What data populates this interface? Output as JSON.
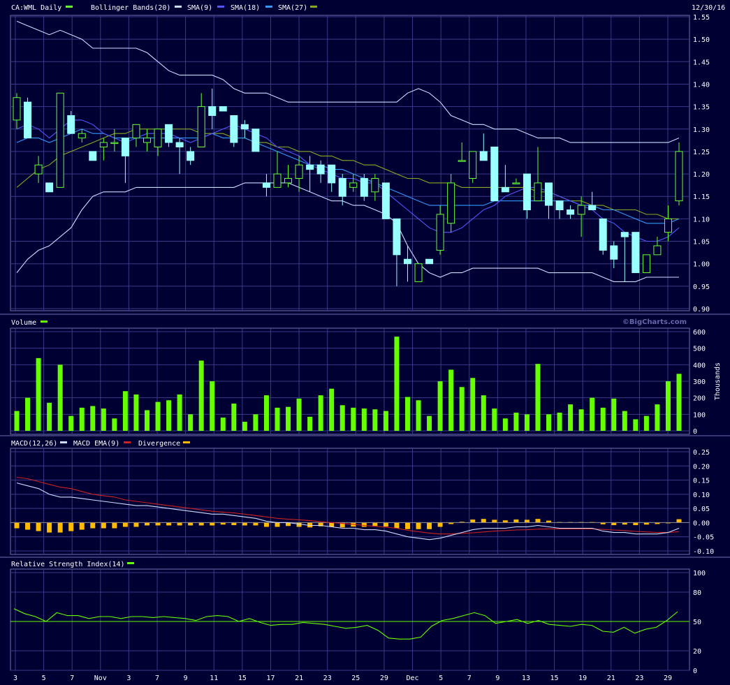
{
  "header": {
    "symbol_label": "CA:WML Daily",
    "bb_label": "Bollinger Bands(20)",
    "sma9_label": "SMA(9)",
    "sma18_label": "SMA(18)",
    "sma27_label": "SMA(27)",
    "date_label": "12/30/16"
  },
  "colors": {
    "background": "#000033",
    "grid": "#3a3a8a",
    "up": "#000033",
    "up_border": "#66ff33",
    "down": "#99ffff",
    "bollinger": "#ccddff",
    "sma9": "#5555ff",
    "sma18": "#3399ff",
    "sma27": "#88aa22",
    "volume": "#66ff00",
    "macd": "#ccddff",
    "macd_ema": "#cc2222",
    "divergence": "#ffbb00",
    "rsi": "#66ff00"
  },
  "watermark": "©BigCharts.com",
  "chart_data": [
    {
      "type": "candlestick",
      "title": "CA:WML Daily",
      "ylim": [
        0.9,
        1.55
      ],
      "yticks": [
        "1.55",
        "1.50",
        "1.45",
        "1.40",
        "1.35",
        "1.30",
        "1.25",
        "1.20",
        "1.15",
        "1.10",
        "1.05",
        "1.00",
        "0.95",
        "0.90"
      ],
      "xticks": [
        "3",
        "5",
        "7",
        "Nov",
        "3",
        "7",
        "9",
        "11",
        "15",
        "17",
        "21",
        "23",
        "25",
        "29",
        "Dec",
        "5",
        "7",
        "9",
        "13",
        "15",
        "19",
        "21",
        "23",
        "29"
      ],
      "candles": [
        {
          "o": 1.32,
          "h": 1.38,
          "l": 1.3,
          "c": 1.37
        },
        {
          "o": 1.36,
          "h": 1.37,
          "l": 1.28,
          "c": 1.28
        },
        {
          "o": 1.2,
          "h": 1.24,
          "l": 1.18,
          "c": 1.22
        },
        {
          "o": 1.18,
          "h": 1.18,
          "l": 1.16,
          "c": 1.16
        },
        {
          "o": 1.17,
          "h": 1.38,
          "l": 1.17,
          "c": 1.38
        },
        {
          "o": 1.33,
          "h": 1.34,
          "l": 1.29,
          "c": 1.29
        },
        {
          "o": 1.28,
          "h": 1.3,
          "l": 1.27,
          "c": 1.29
        },
        {
          "o": 1.25,
          "h": 1.25,
          "l": 1.23,
          "c": 1.23
        },
        {
          "o": 1.26,
          "h": 1.28,
          "l": 1.23,
          "c": 1.27
        },
        {
          "o": 1.27,
          "h": 1.3,
          "l": 1.25,
          "c": 1.27
        },
        {
          "o": 1.28,
          "h": 1.28,
          "l": 1.18,
          "c": 1.24
        },
        {
          "o": 1.28,
          "h": 1.31,
          "l": 1.26,
          "c": 1.31
        },
        {
          "o": 1.27,
          "h": 1.3,
          "l": 1.25,
          "c": 1.28
        },
        {
          "o": 1.26,
          "h": 1.3,
          "l": 1.24,
          "c": 1.3
        },
        {
          "o": 1.31,
          "h": 1.31,
          "l": 1.26,
          "c": 1.27
        },
        {
          "o": 1.27,
          "h": 1.28,
          "l": 1.2,
          "c": 1.26
        },
        {
          "o": 1.25,
          "h": 1.26,
          "l": 1.22,
          "c": 1.23
        },
        {
          "o": 1.26,
          "h": 1.38,
          "l": 1.26,
          "c": 1.35
        },
        {
          "o": 1.35,
          "h": 1.39,
          "l": 1.3,
          "c": 1.33
        },
        {
          "o": 1.35,
          "h": 1.35,
          "l": 1.34,
          "c": 1.34
        },
        {
          "o": 1.33,
          "h": 1.33,
          "l": 1.26,
          "c": 1.27
        },
        {
          "o": 1.31,
          "h": 1.32,
          "l": 1.28,
          "c": 1.3
        },
        {
          "o": 1.3,
          "h": 1.3,
          "l": 1.25,
          "c": 1.25
        },
        {
          "o": 1.18,
          "h": 1.2,
          "l": 1.15,
          "c": 1.17
        },
        {
          "o": 1.17,
          "h": 1.25,
          "l": 1.17,
          "c": 1.2
        },
        {
          "o": 1.18,
          "h": 1.22,
          "l": 1.17,
          "c": 1.19
        },
        {
          "o": 1.19,
          "h": 1.24,
          "l": 1.16,
          "c": 1.22
        },
        {
          "o": 1.22,
          "h": 1.24,
          "l": 1.16,
          "c": 1.21
        },
        {
          "o": 1.22,
          "h": 1.23,
          "l": 1.18,
          "c": 1.2
        },
        {
          "o": 1.22,
          "h": 1.22,
          "l": 1.16,
          "c": 1.18
        },
        {
          "o": 1.19,
          "h": 1.2,
          "l": 1.13,
          "c": 1.15
        },
        {
          "o": 1.17,
          "h": 1.2,
          "l": 1.16,
          "c": 1.18
        },
        {
          "o": 1.19,
          "h": 1.2,
          "l": 1.14,
          "c": 1.15
        },
        {
          "o": 1.16,
          "h": 1.2,
          "l": 1.14,
          "c": 1.19
        },
        {
          "o": 1.18,
          "h": 1.18,
          "l": 1.1,
          "c": 1.1
        },
        {
          "o": 1.1,
          "h": 1.1,
          "l": 0.95,
          "c": 1.02
        },
        {
          "o": 1.01,
          "h": 1.04,
          "l": 0.96,
          "c": 1.0
        },
        {
          "o": 0.96,
          "h": 1.0,
          "l": 0.96,
          "c": 1.0
        },
        {
          "o": 1.01,
          "h": 1.01,
          "l": 1.0,
          "c": 1.0
        },
        {
          "o": 1.03,
          "h": 1.13,
          "l": 1.02,
          "c": 1.11
        },
        {
          "o": 1.09,
          "h": 1.2,
          "l": 1.07,
          "c": 1.18
        },
        {
          "o": 1.23,
          "h": 1.27,
          "l": 1.23,
          "c": 1.23
        },
        {
          "o": 1.19,
          "h": 1.25,
          "l": 1.18,
          "c": 1.25
        },
        {
          "o": 1.25,
          "h": 1.29,
          "l": 1.23,
          "c": 1.23
        },
        {
          "o": 1.26,
          "h": 1.26,
          "l": 1.14,
          "c": 1.14
        },
        {
          "o": 1.17,
          "h": 1.22,
          "l": 1.16,
          "c": 1.16
        },
        {
          "o": 1.18,
          "h": 1.19,
          "l": 1.18,
          "c": 1.18
        },
        {
          "o": 1.2,
          "h": 1.2,
          "l": 1.1,
          "c": 1.12
        },
        {
          "o": 1.14,
          "h": 1.26,
          "l": 1.14,
          "c": 1.18
        },
        {
          "o": 1.18,
          "h": 1.18,
          "l": 1.1,
          "c": 1.13
        },
        {
          "o": 1.14,
          "h": 1.14,
          "l": 1.1,
          "c": 1.12
        },
        {
          "o": 1.12,
          "h": 1.13,
          "l": 1.1,
          "c": 1.11
        },
        {
          "o": 1.11,
          "h": 1.15,
          "l": 1.06,
          "c": 1.13
        },
        {
          "o": 1.13,
          "h": 1.16,
          "l": 1.12,
          "c": 1.12
        },
        {
          "o": 1.1,
          "h": 1.1,
          "l": 1.02,
          "c": 1.03
        },
        {
          "o": 1.04,
          "h": 1.05,
          "l": 0.99,
          "c": 1.01
        },
        {
          "o": 1.07,
          "h": 1.07,
          "l": 0.96,
          "c": 1.06
        },
        {
          "o": 1.07,
          "h": 1.07,
          "l": 0.98,
          "c": 0.98
        },
        {
          "o": 0.98,
          "h": 1.02,
          "l": 0.98,
          "c": 1.02
        },
        {
          "o": 1.02,
          "h": 1.06,
          "l": 1.02,
          "c": 1.04
        },
        {
          "o": 1.07,
          "h": 1.13,
          "l": 1.05,
          "c": 1.1
        },
        {
          "o": 1.14,
          "h": 1.27,
          "l": 1.13,
          "c": 1.25
        }
      ],
      "bollinger_upper": [
        1.54,
        1.53,
        1.52,
        1.51,
        1.52,
        1.51,
        1.5,
        1.48,
        1.48,
        1.48,
        1.48,
        1.48,
        1.47,
        1.45,
        1.43,
        1.42,
        1.42,
        1.42,
        1.42,
        1.41,
        1.39,
        1.38,
        1.38,
        1.38,
        1.37,
        1.36,
        1.36,
        1.36,
        1.36,
        1.36,
        1.36,
        1.36,
        1.36,
        1.36,
        1.36,
        1.36,
        1.38,
        1.39,
        1.38,
        1.36,
        1.33,
        1.32,
        1.31,
        1.31,
        1.3,
        1.3,
        1.3,
        1.29,
        1.28,
        1.28,
        1.28,
        1.27,
        1.27,
        1.27,
        1.27,
        1.27,
        1.27,
        1.27,
        1.27,
        1.27,
        1.27,
        1.28
      ],
      "bollinger_lower": [
        0.98,
        1.01,
        1.03,
        1.04,
        1.06,
        1.08,
        1.12,
        1.15,
        1.16,
        1.16,
        1.16,
        1.17,
        1.17,
        1.17,
        1.17,
        1.17,
        1.17,
        1.17,
        1.17,
        1.17,
        1.17,
        1.18,
        1.18,
        1.18,
        1.18,
        1.18,
        1.17,
        1.16,
        1.15,
        1.14,
        1.14,
        1.13,
        1.13,
        1.12,
        1.11,
        1.09,
        1.04,
        1.0,
        0.98,
        0.97,
        0.98,
        0.98,
        0.99,
        0.99,
        0.99,
        0.99,
        0.99,
        0.99,
        0.99,
        0.98,
        0.98,
        0.98,
        0.98,
        0.98,
        0.97,
        0.96,
        0.96,
        0.96,
        0.97,
        0.97,
        0.97,
        0.97
      ],
      "sma9": [
        1.3,
        1.31,
        1.3,
        1.28,
        1.3,
        1.32,
        1.32,
        1.31,
        1.29,
        1.28,
        1.27,
        1.28,
        1.29,
        1.29,
        1.29,
        1.28,
        1.27,
        1.28,
        1.29,
        1.3,
        1.31,
        1.3,
        1.29,
        1.28,
        1.26,
        1.25,
        1.24,
        1.22,
        1.21,
        1.2,
        1.19,
        1.19,
        1.18,
        1.18,
        1.16,
        1.14,
        1.12,
        1.1,
        1.08,
        1.07,
        1.07,
        1.08,
        1.1,
        1.12,
        1.13,
        1.15,
        1.16,
        1.17,
        1.17,
        1.16,
        1.15,
        1.14,
        1.13,
        1.12,
        1.1,
        1.09,
        1.07,
        1.06,
        1.05,
        1.05,
        1.06,
        1.08
      ],
      "sma18": [
        1.27,
        1.28,
        1.28,
        1.27,
        1.28,
        1.29,
        1.3,
        1.29,
        1.29,
        1.28,
        1.28,
        1.28,
        1.28,
        1.28,
        1.28,
        1.28,
        1.28,
        1.28,
        1.29,
        1.28,
        1.28,
        1.28,
        1.27,
        1.26,
        1.25,
        1.24,
        1.23,
        1.22,
        1.22,
        1.21,
        1.21,
        1.2,
        1.19,
        1.18,
        1.17,
        1.16,
        1.15,
        1.14,
        1.13,
        1.13,
        1.13,
        1.13,
        1.13,
        1.13,
        1.14,
        1.14,
        1.14,
        1.14,
        1.14,
        1.14,
        1.14,
        1.14,
        1.13,
        1.13,
        1.12,
        1.12,
        1.11,
        1.1,
        1.09,
        1.09,
        1.09,
        1.1
      ],
      "sma27": [
        1.17,
        1.19,
        1.21,
        1.22,
        1.24,
        1.25,
        1.26,
        1.27,
        1.28,
        1.29,
        1.29,
        1.3,
        1.3,
        1.3,
        1.3,
        1.3,
        1.3,
        1.29,
        1.29,
        1.29,
        1.28,
        1.28,
        1.27,
        1.27,
        1.26,
        1.26,
        1.25,
        1.25,
        1.24,
        1.24,
        1.23,
        1.23,
        1.22,
        1.22,
        1.21,
        1.2,
        1.19,
        1.19,
        1.18,
        1.18,
        1.18,
        1.17,
        1.17,
        1.17,
        1.17,
        1.17,
        1.17,
        1.17,
        1.16,
        1.16,
        1.15,
        1.14,
        1.14,
        1.13,
        1.13,
        1.12,
        1.12,
        1.12,
        1.11,
        1.11,
        1.1,
        1.1
      ]
    },
    {
      "type": "bar",
      "title": "Volume",
      "ylabel": "Thousands",
      "ylim": [
        0,
        600
      ],
      "yticks": [
        "600",
        "500",
        "400",
        "300",
        "200",
        "100",
        "0"
      ],
      "values": [
        120,
        200,
        440,
        170,
        400,
        90,
        140,
        150,
        135,
        75,
        240,
        220,
        125,
        175,
        185,
        220,
        100,
        425,
        300,
        80,
        165,
        55,
        100,
        215,
        140,
        145,
        195,
        85,
        215,
        255,
        155,
        140,
        135,
        130,
        120,
        570,
        205,
        185,
        90,
        300,
        370,
        265,
        320,
        215,
        135,
        75,
        110,
        100,
        405,
        100,
        110,
        160,
        130,
        200,
        140,
        195,
        120,
        70,
        90,
        160,
        300,
        345
      ]
    },
    {
      "type": "line",
      "title": "MACD(12,26)",
      "ylim": [
        -0.1,
        0.25
      ],
      "yticks": [
        "0.25",
        "0.20",
        "0.15",
        "0.10",
        "0.05",
        "0.00",
        "-0.05",
        "-0.10"
      ],
      "series": [
        {
          "name": "MACD(12,26)",
          "values": [
            0.14,
            0.13,
            0.12,
            0.1,
            0.09,
            0.09,
            0.085,
            0.08,
            0.075,
            0.07,
            0.065,
            0.06,
            0.06,
            0.055,
            0.05,
            0.045,
            0.04,
            0.035,
            0.03,
            0.03,
            0.025,
            0.02,
            0.015,
            0.005,
            0.0,
            0.0,
            -0.005,
            -0.01,
            -0.01,
            -0.015,
            -0.02,
            -0.02,
            -0.025,
            -0.025,
            -0.03,
            -0.04,
            -0.05,
            -0.055,
            -0.06,
            -0.055,
            -0.045,
            -0.035,
            -0.025,
            -0.02,
            -0.02,
            -0.02,
            -0.015,
            -0.015,
            -0.01,
            -0.015,
            -0.02,
            -0.02,
            -0.02,
            -0.02,
            -0.03,
            -0.035,
            -0.035,
            -0.04,
            -0.04,
            -0.04,
            -0.035,
            -0.02
          ]
        },
        {
          "name": "MACD EMA(9)",
          "values": [
            0.16,
            0.155,
            0.145,
            0.135,
            0.125,
            0.12,
            0.11,
            0.1,
            0.095,
            0.09,
            0.08,
            0.075,
            0.07,
            0.065,
            0.06,
            0.055,
            0.05,
            0.045,
            0.04,
            0.037,
            0.034,
            0.03,
            0.025,
            0.02,
            0.015,
            0.012,
            0.01,
            0.007,
            0.003,
            0.0,
            -0.003,
            -0.006,
            -0.01,
            -0.013,
            -0.016,
            -0.02,
            -0.027,
            -0.032,
            -0.037,
            -0.04,
            -0.04,
            -0.038,
            -0.036,
            -0.033,
            -0.03,
            -0.028,
            -0.026,
            -0.025,
            -0.023,
            -0.022,
            -0.022,
            -0.022,
            -0.022,
            -0.022,
            -0.024,
            -0.026,
            -0.028,
            -0.031,
            -0.033,
            -0.035,
            -0.035,
            -0.032
          ]
        },
        {
          "name": "Divergence",
          "values": [
            -0.02,
            -0.025,
            -0.03,
            -0.035,
            -0.035,
            -0.03,
            -0.025,
            -0.02,
            -0.02,
            -0.02,
            -0.015,
            -0.015,
            -0.01,
            -0.01,
            -0.01,
            -0.01,
            -0.01,
            -0.01,
            -0.01,
            -0.007,
            -0.009,
            -0.01,
            -0.01,
            -0.015,
            -0.015,
            -0.012,
            -0.015,
            -0.017,
            -0.013,
            -0.015,
            -0.017,
            -0.014,
            -0.015,
            -0.012,
            -0.014,
            -0.02,
            -0.023,
            -0.023,
            -0.023,
            -0.015,
            -0.005,
            0.003,
            0.011,
            0.013,
            0.01,
            0.008,
            0.011,
            0.01,
            0.013,
            0.007,
            0.002,
            0.002,
            0.002,
            0.002,
            -0.006,
            -0.009,
            -0.007,
            -0.009,
            -0.007,
            -0.005,
            0.0,
            0.012
          ]
        }
      ]
    },
    {
      "type": "line",
      "title": "Relative Strength Index(14)",
      "ylim": [
        0,
        100
      ],
      "yticks": [
        "100",
        "80",
        "50",
        "20",
        "0"
      ],
      "reference": 50,
      "values": [
        63,
        58,
        55,
        50,
        59,
        56,
        56,
        53,
        55,
        55,
        53,
        55,
        55,
        54,
        55,
        54,
        53,
        51,
        55,
        56,
        55,
        50,
        53,
        49,
        46,
        47,
        47,
        49,
        48,
        47,
        45,
        43,
        44,
        46,
        41,
        33,
        32,
        32,
        34,
        45,
        51,
        53,
        56,
        59,
        56,
        48,
        50,
        52,
        48,
        51,
        47,
        46,
        45,
        47,
        46,
        40,
        39,
        44,
        38,
        42,
        44,
        51,
        60
      ]
    }
  ],
  "volume_panel": {
    "label": "Volume"
  },
  "macd_panel": {
    "label": "MACD(12,26)",
    "ema_label": "MACD EMA(9)",
    "div_label": "Divergence"
  },
  "rsi_panel": {
    "label": "Relative Strength Index(14)"
  }
}
